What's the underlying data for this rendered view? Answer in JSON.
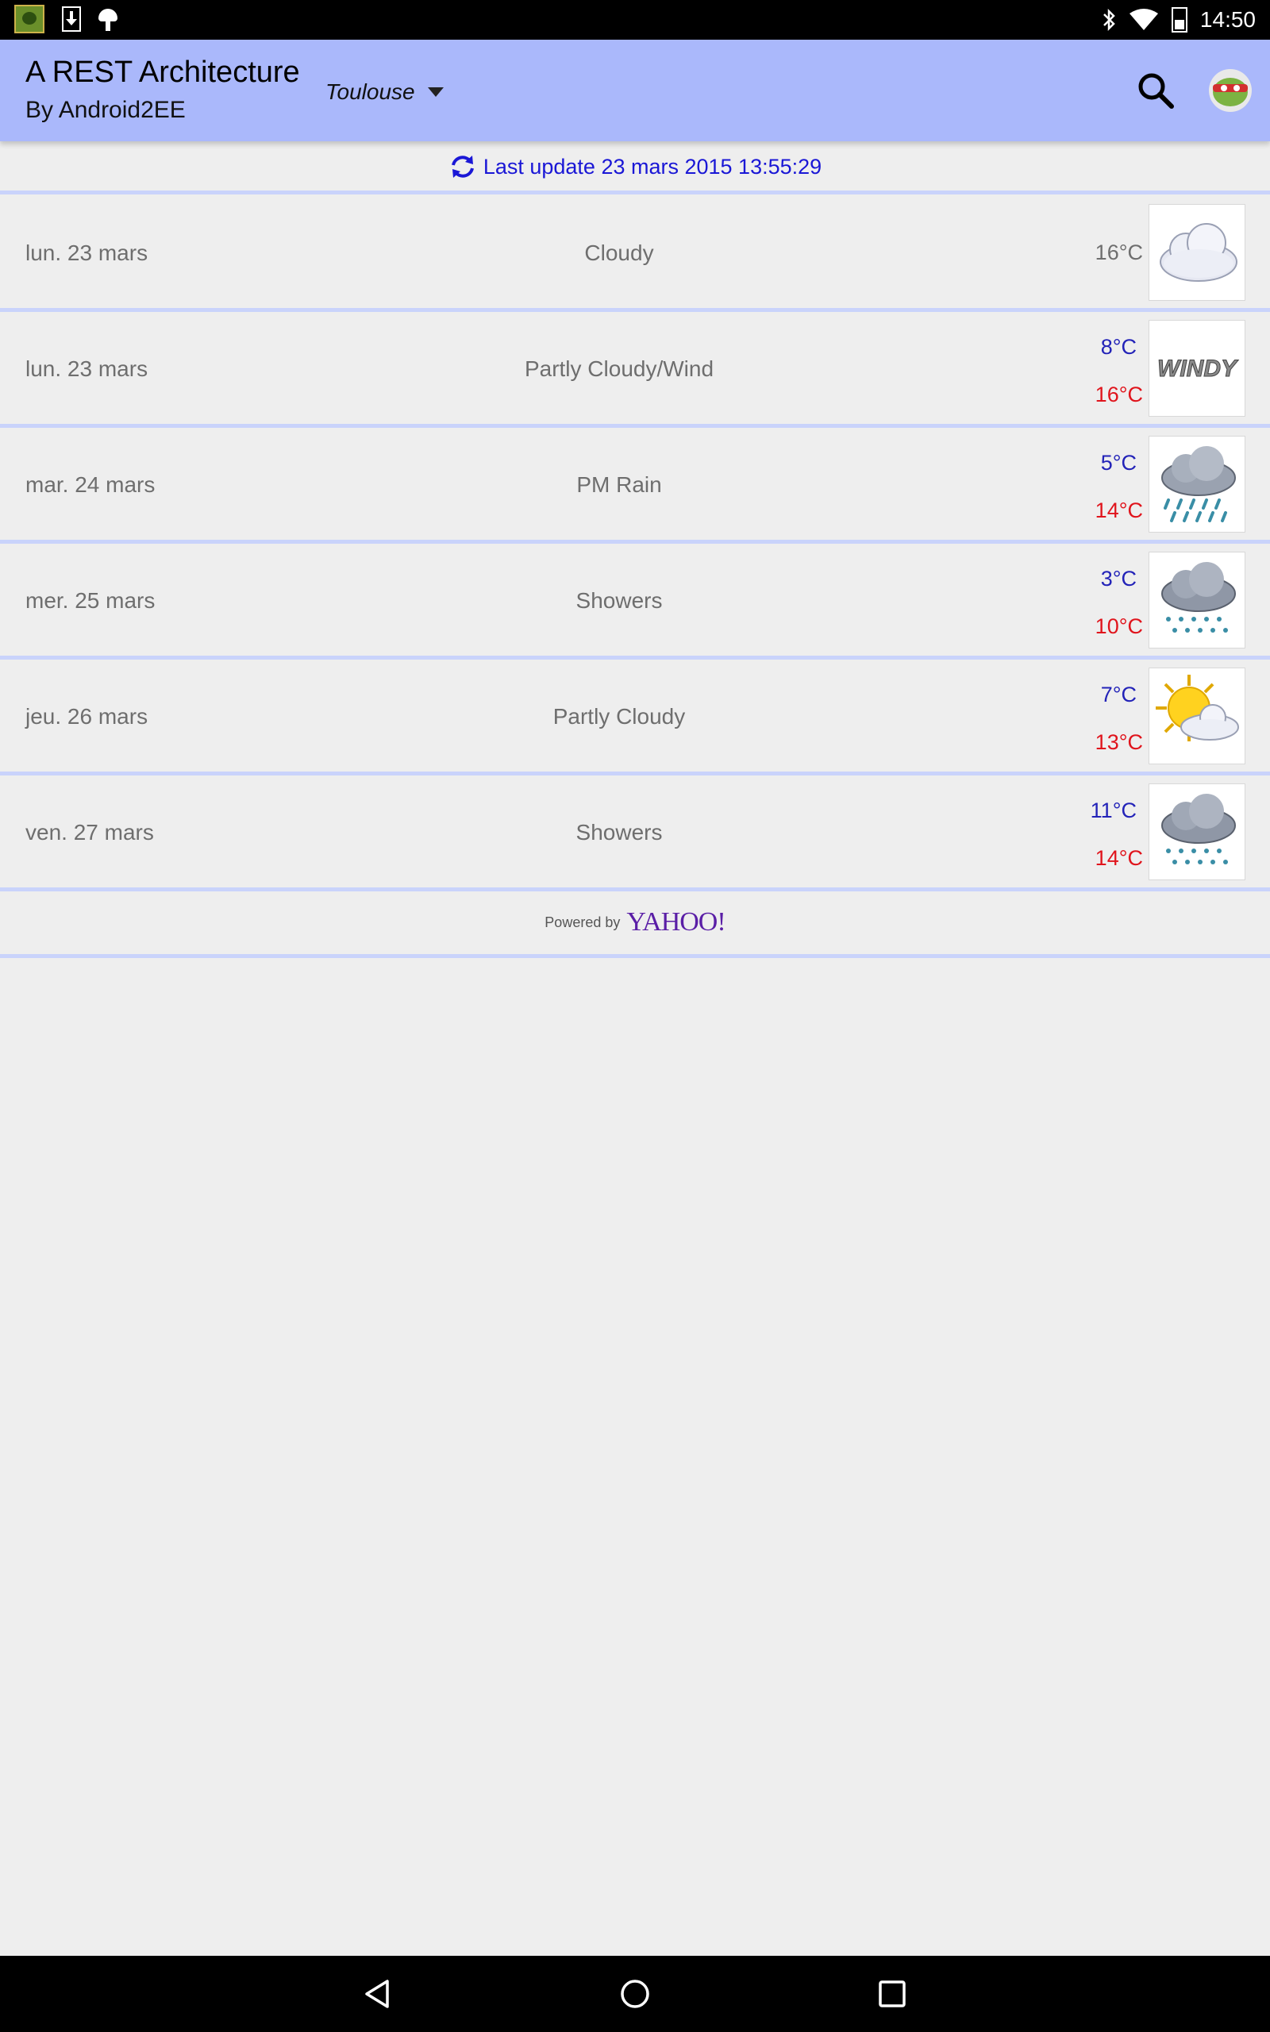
{
  "status_bar": {
    "time": "14:50",
    "icons": [
      "app-notification-icon",
      "download-icon",
      "android-icon",
      "bluetooth-icon",
      "wifi-icon",
      "battery-icon"
    ]
  },
  "app_bar": {
    "title": "A REST Architecture",
    "subtitle": "By Android2EE",
    "city": "Toulouse",
    "icons": [
      "search-icon",
      "avatar-icon"
    ],
    "background": "#aab8fb"
  },
  "update": {
    "text": "Last update 23 mars 2015 13:55:29",
    "color": "#1a17d6"
  },
  "forecast": [
    {
      "date": "lun. 23 mars",
      "desc": "Cloudy",
      "temp": "16°C",
      "icon": "cloudy-icon"
    },
    {
      "date": "lun. 23 mars",
      "desc": "Partly Cloudy/Wind",
      "low": "8°C",
      "high": "16°C",
      "icon": "windy-icon",
      "icon_text": "WINDY"
    },
    {
      "date": "mar. 24 mars",
      "desc": "PM Rain",
      "low": "5°C",
      "high": "14°C",
      "icon": "rain-icon"
    },
    {
      "date": "mer. 25 mars",
      "desc": "Showers",
      "low": "3°C",
      "high": "10°C",
      "icon": "showers-icon"
    },
    {
      "date": "jeu. 26 mars",
      "desc": "Partly Cloudy",
      "low": "7°C",
      "high": "13°C",
      "icon": "partly-cloudy-icon"
    },
    {
      "date": "ven. 27 mars",
      "desc": "Showers",
      "low": "11°C",
      "high": "14°C",
      "icon": "showers-icon"
    }
  ],
  "footer": {
    "powered_by": "Powered by",
    "brand": "YAHOO!"
  },
  "colors": {
    "low_temp": "#2323b8",
    "high_temp": "#e0141c",
    "divider": "#c9d3fb"
  },
  "nav_bar": {
    "icons": [
      "back-icon",
      "home-icon",
      "recents-icon"
    ]
  }
}
